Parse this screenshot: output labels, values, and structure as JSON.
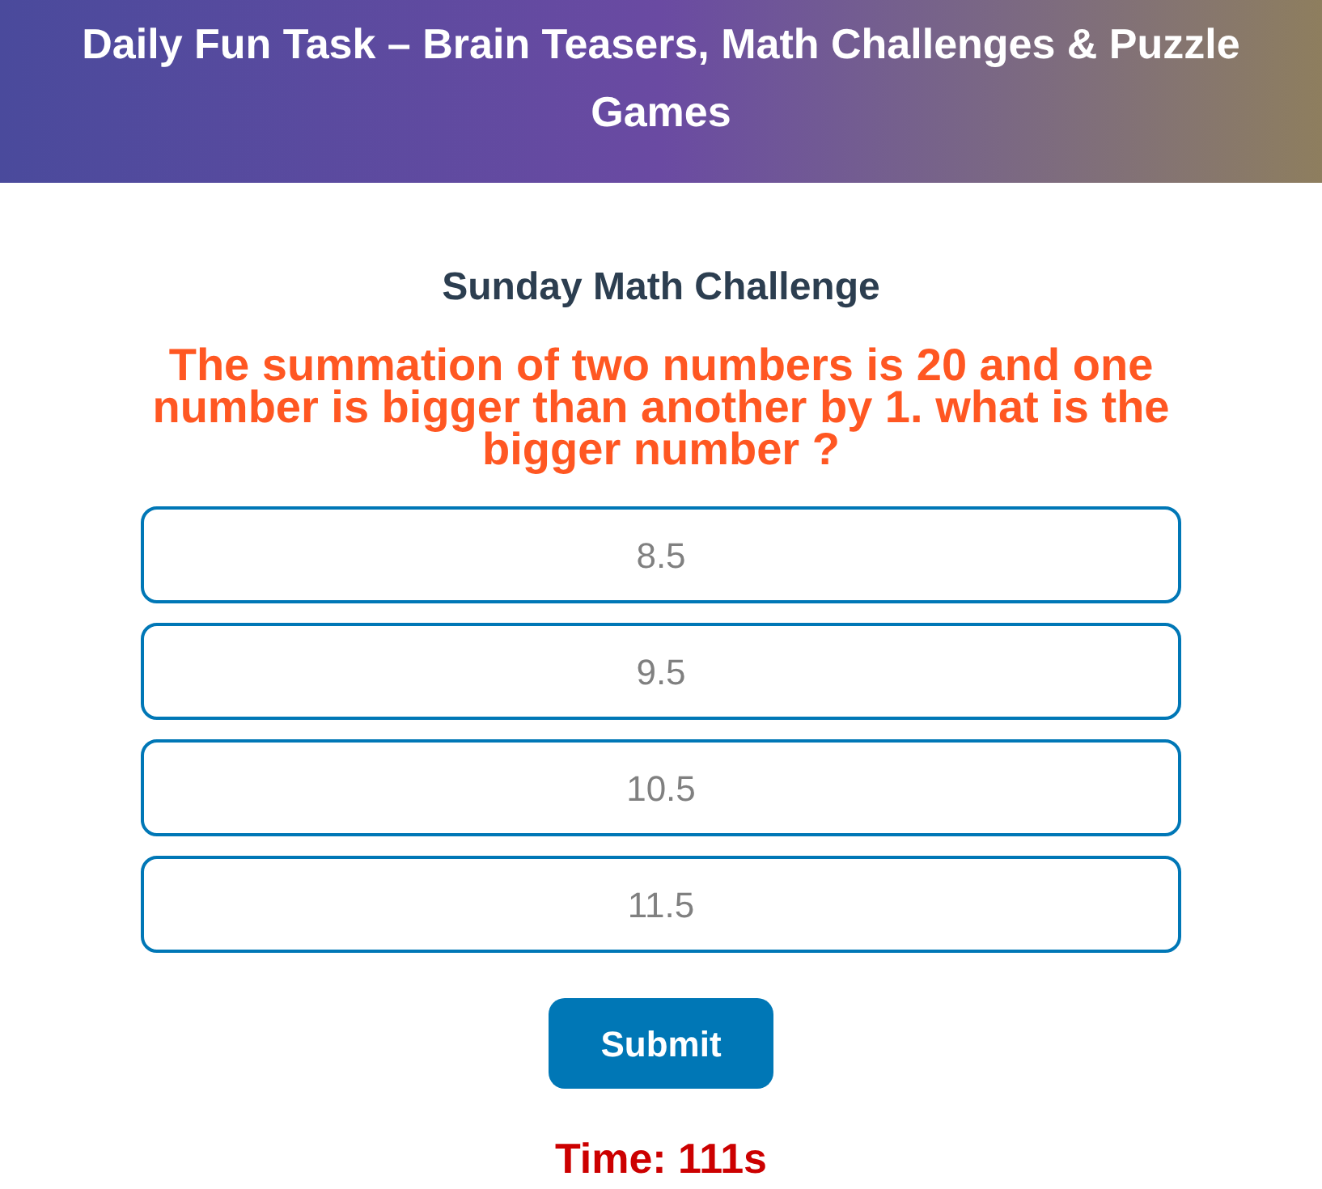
{
  "header": {
    "title": "Daily Fun Task – Brain Teasers, Math Challenges & Puzzle Games"
  },
  "quiz": {
    "title": "Sunday Math Challenge",
    "question": "The summation of two numbers is 20 and one number is bigger than another by 1. what is the bigger number ?",
    "options": [
      {
        "label": "8.5",
        "selected": false
      },
      {
        "label": "9.5",
        "selected": false
      },
      {
        "label": "10.5",
        "selected": false
      },
      {
        "label": "11.5",
        "selected": false
      }
    ],
    "submit": "Submit",
    "timer": "Time: 111s"
  }
}
